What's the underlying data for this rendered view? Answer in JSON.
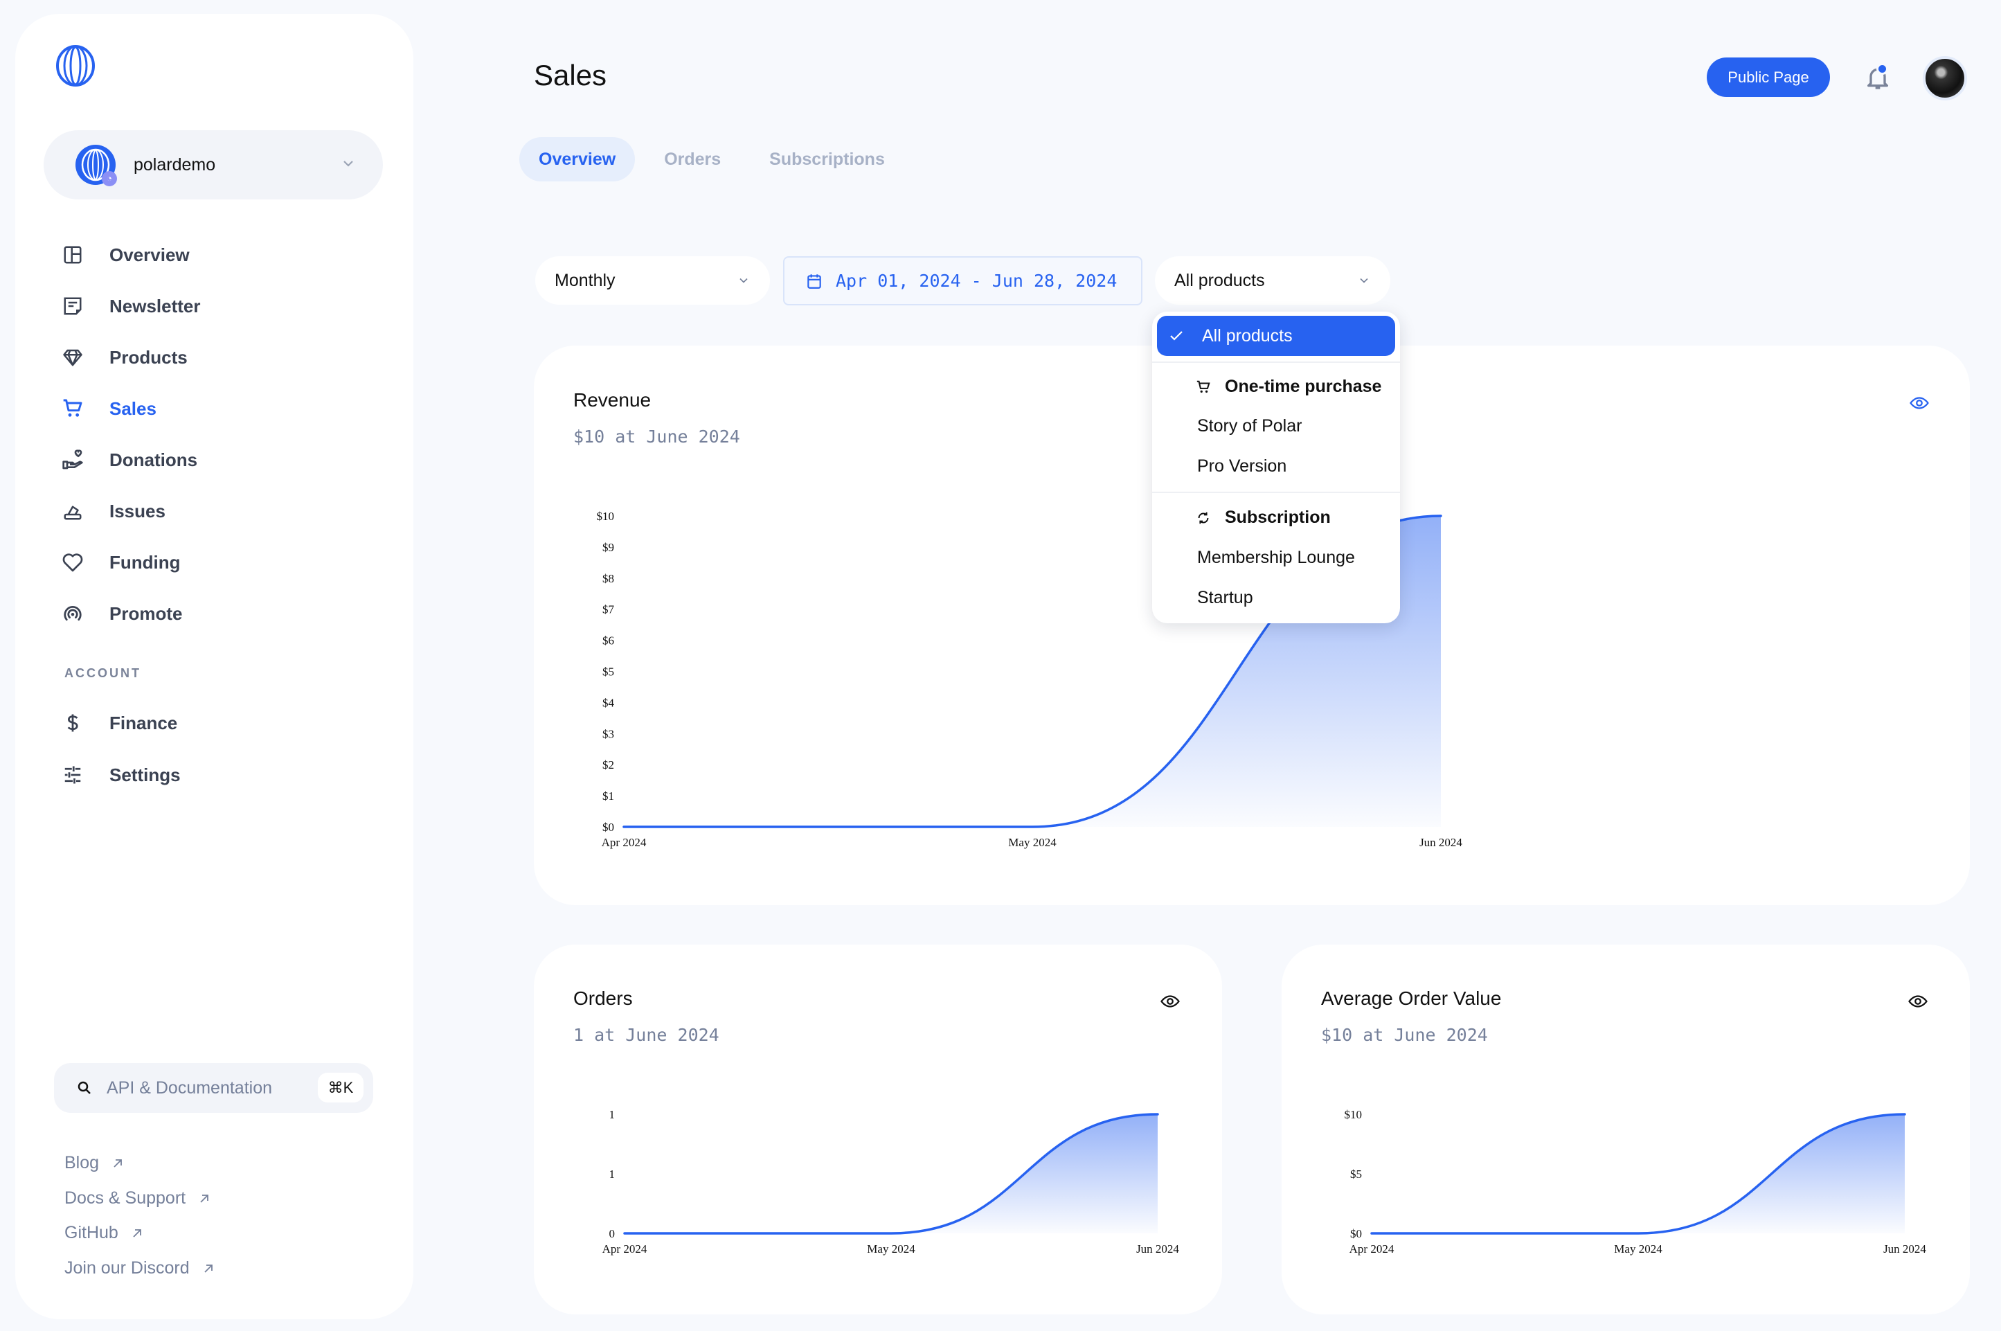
{
  "sidebar": {
    "logo_icon": "polar-logo-icon",
    "org": {
      "name": "polardemo",
      "badge_icon": "github-icon"
    },
    "nav": [
      {
        "label": "Overview",
        "icon": "layout-icon",
        "active": false
      },
      {
        "label": "Newsletter",
        "icon": "newsletter-icon",
        "active": false
      },
      {
        "label": "Products",
        "icon": "diamond-icon",
        "active": false
      },
      {
        "label": "Sales",
        "icon": "cart-icon",
        "active": true
      },
      {
        "label": "Donations",
        "icon": "hand-heart-icon",
        "active": false
      },
      {
        "label": "Issues",
        "icon": "eraser-icon",
        "active": false
      },
      {
        "label": "Funding",
        "icon": "heart-icon",
        "active": false
      },
      {
        "label": "Promote",
        "icon": "broadcast-icon",
        "active": false
      }
    ],
    "account_label": "ACCOUNT",
    "account_nav": [
      {
        "label": "Finance",
        "icon": "dollar-icon"
      },
      {
        "label": "Settings",
        "icon": "sliders-icon"
      }
    ],
    "search": {
      "label": "API & Documentation",
      "shortcut": "⌘K"
    },
    "links": [
      {
        "label": "Blog"
      },
      {
        "label": "Docs & Support"
      },
      {
        "label": "GitHub"
      },
      {
        "label": "Join our Discord"
      }
    ]
  },
  "header": {
    "title": "Sales",
    "tabs": [
      {
        "label": "Overview",
        "active": true
      },
      {
        "label": "Orders",
        "active": false
      },
      {
        "label": "Subscriptions",
        "active": false
      }
    ],
    "public_page_label": "Public Page",
    "notifications_unread": true
  },
  "filters": {
    "interval": "Monthly",
    "date_range": "Apr 01, 2024 - Jun 28, 2024",
    "product": "All products"
  },
  "product_dropdown": {
    "selected": "All products",
    "groups": [
      {
        "label": "One-time purchase",
        "icon": "cart-icon",
        "items": [
          "Story of Polar",
          "Pro Version"
        ]
      },
      {
        "label": "Subscription",
        "icon": "refresh-icon",
        "items": [
          "Membership Lounge",
          "Startup"
        ]
      }
    ]
  },
  "colors": {
    "accent": "#2762f0",
    "background": "#f7f9fd",
    "muted_text": "#75809a"
  },
  "cards": {
    "revenue": {
      "title": "Revenue",
      "subtitle": "$10 at June 2024"
    },
    "orders": {
      "title": "Orders",
      "subtitle": "1 at June 2024"
    },
    "aov": {
      "title": "Average Order Value",
      "subtitle": "$10 at June 2024"
    }
  },
  "chart_data": [
    {
      "type": "area",
      "title": "Revenue",
      "categories": [
        "Apr 2024",
        "May 2024",
        "Jun 2024"
      ],
      "values": [
        0,
        0,
        10
      ],
      "ylim": [
        0,
        10
      ],
      "yticks": [
        "$0",
        "$1",
        "$2",
        "$3",
        "$4",
        "$5",
        "$6",
        "$7",
        "$8",
        "$9",
        "$10"
      ],
      "grid": false
    },
    {
      "type": "area",
      "title": "Orders",
      "categories": [
        "Apr 2024",
        "May 2024",
        "Jun 2024"
      ],
      "values": [
        0,
        0,
        1
      ],
      "ylim": [
        0,
        1
      ],
      "yticks": [
        "0",
        "1",
        "1"
      ],
      "grid": false
    },
    {
      "type": "area",
      "title": "Average Order Value",
      "categories": [
        "Apr 2024",
        "May 2024",
        "Jun 2024"
      ],
      "values": [
        0,
        0,
        10
      ],
      "ylim": [
        0,
        10
      ],
      "yticks": [
        "$0",
        "$5",
        "$10"
      ],
      "grid": false
    }
  ]
}
